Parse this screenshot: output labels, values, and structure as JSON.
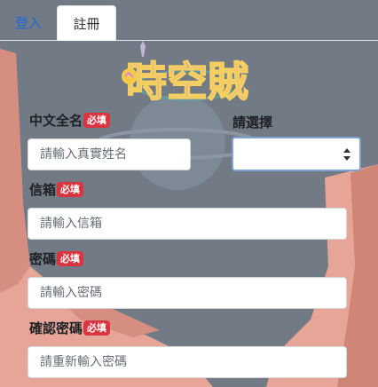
{
  "tabs": {
    "login": "登入",
    "register": "註冊"
  },
  "logo": {
    "text": "時空賊"
  },
  "form": {
    "name": {
      "label": "中文全名",
      "required": "必填",
      "placeholder": "請輸入真實姓名"
    },
    "select": {
      "label": "請選擇",
      "value": ""
    },
    "email": {
      "label": "信箱",
      "required": "必填",
      "placeholder": "請輸入信箱"
    },
    "password": {
      "label": "密碼",
      "required": "必填",
      "placeholder": "請輸入密碼"
    },
    "confirm": {
      "label": "確認密碼",
      "required": "必填",
      "placeholder": "請重新輸入密碼"
    }
  },
  "icons": {
    "select_arrow": "sort-arrows-icon"
  },
  "colors": {
    "required_badge": "#d9343f",
    "active_tab_text": "#1f66d8",
    "background": "#717a85",
    "canyon": "#e7a597"
  }
}
